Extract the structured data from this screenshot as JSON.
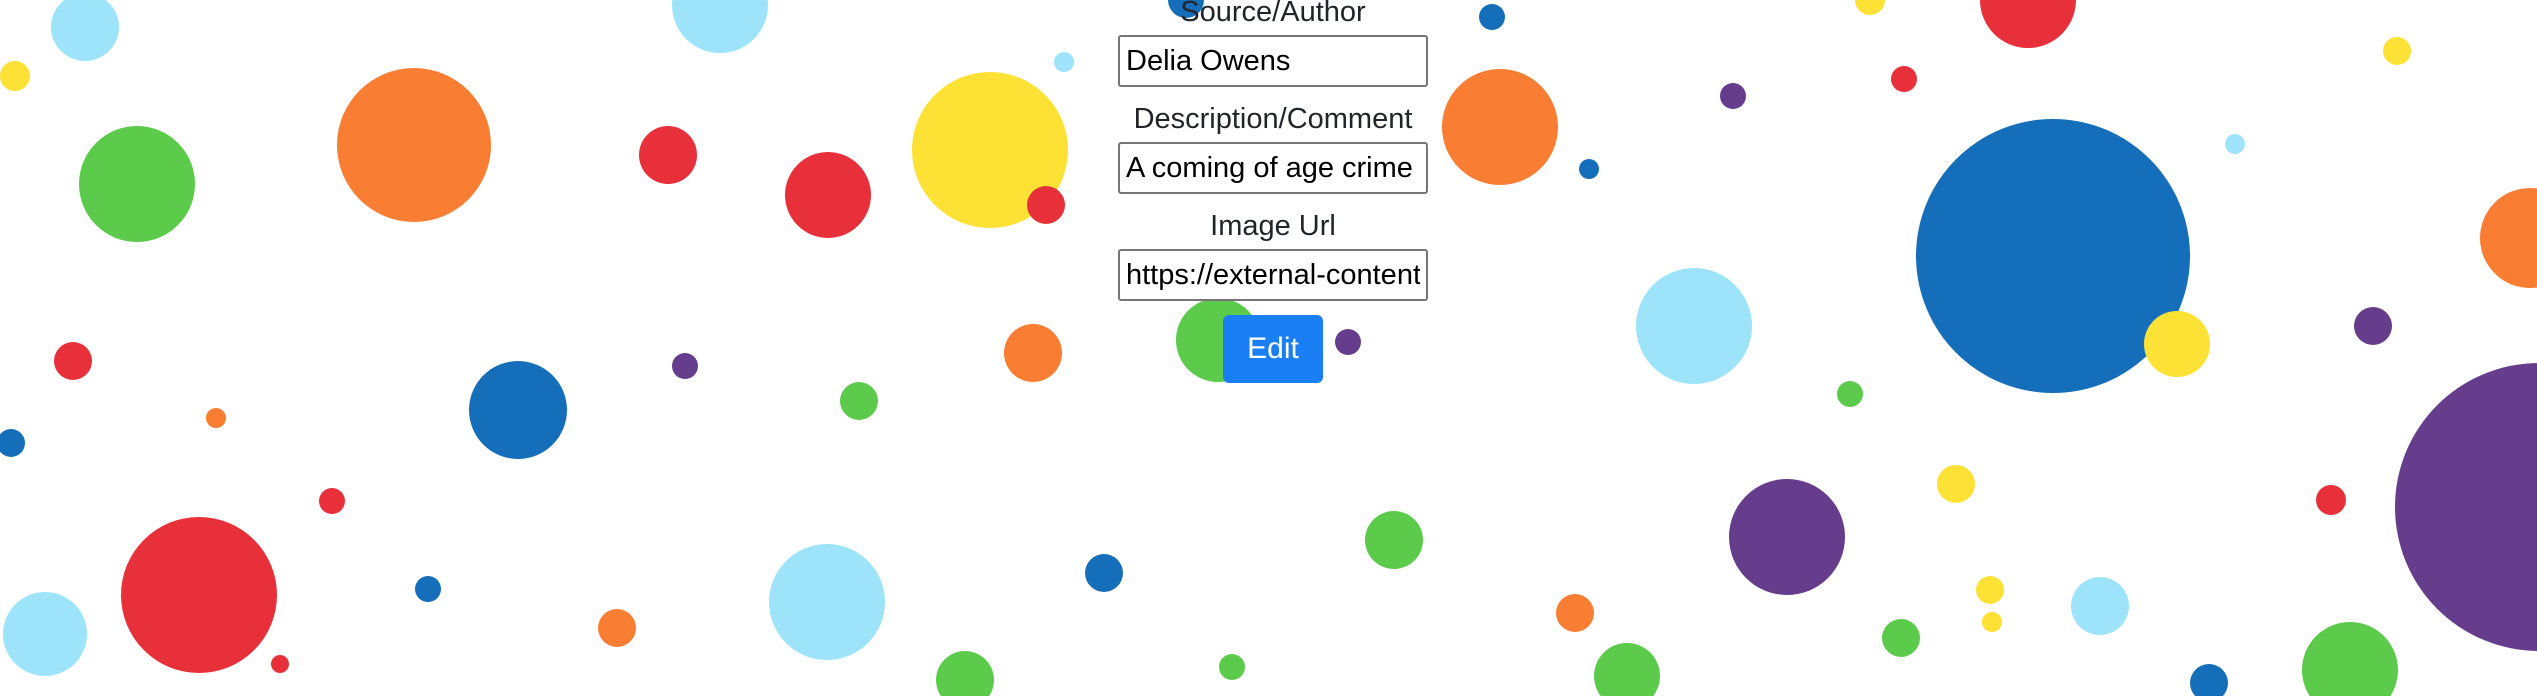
{
  "form": {
    "source_label": "Source/Author",
    "source_value": "Delia Owens",
    "description_label": "Description/Comment",
    "description_value": "A coming of age crime novel",
    "image_label": "Image Url",
    "image_value": "https://external-content",
    "edit_label": "Edit"
  },
  "background": {
    "pattern": "polka-dots",
    "colors": {
      "red": "#e8303a",
      "orange": "#f97d33",
      "yellow": "#fde135",
      "green": "#5ccb4b",
      "light-blue": "#9de4fa",
      "blue": "#156eb9",
      "purple": "#663d8d"
    }
  }
}
